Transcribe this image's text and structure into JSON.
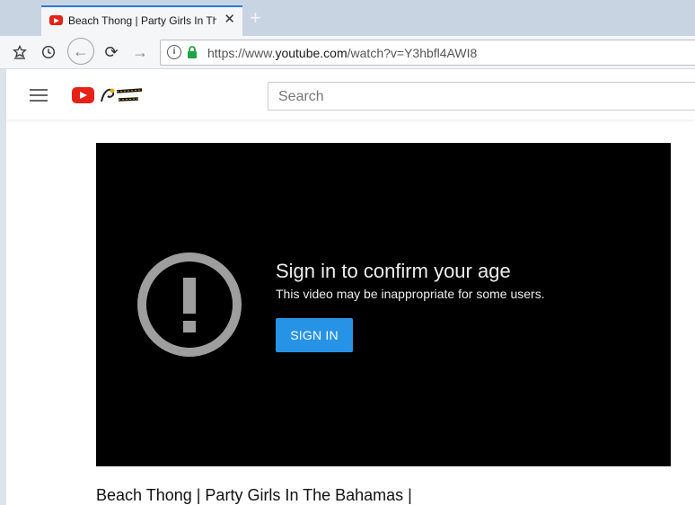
{
  "browser": {
    "tab": {
      "title": "Beach Thong | Party Girls In The Bahamas",
      "close": "✕"
    },
    "new_tab": "+",
    "nav": {
      "back": "←",
      "reload": "⟳",
      "forward": "→"
    },
    "url": {
      "scheme": "https://www.",
      "host": "youtube.com",
      "path": "/watch?v=Y3hbfl4AWI8"
    }
  },
  "youtube": {
    "search_placeholder": "Search",
    "player": {
      "title": "Sign in to confirm your age",
      "subtitle": "This video may be inappropriate for some users.",
      "button": "SIGN IN"
    },
    "video_title": "Beach Thong | Party Girls In The Bahamas |"
  },
  "colors": {
    "accent": "#2793e6",
    "youtube_red": "#e62117",
    "tab_indicator": "#2a7ad6"
  }
}
